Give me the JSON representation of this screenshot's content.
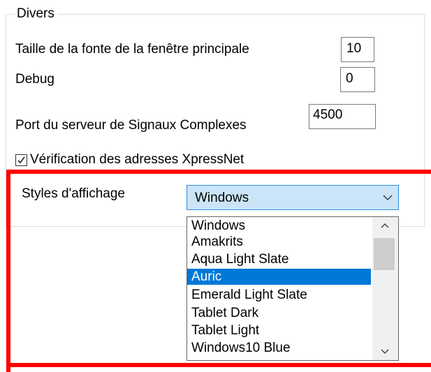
{
  "group": {
    "title": "Divers"
  },
  "fields": {
    "font_size_label": "Taille de la fonte de la fenêtre principale",
    "font_size_value": "10",
    "debug_label": "Debug",
    "debug_value": "0",
    "port_label": "Port du serveur de Signaux Complexes",
    "port_value": "4500",
    "xpressnet_check_label": "Vérification des adresses XpressNet",
    "xpressnet_checked": true
  },
  "display_style": {
    "label": "Styles d'affichage",
    "selected": "Windows",
    "options": [
      "Windows",
      "Amakrits",
      "Aqua Light Slate",
      "Auric",
      "Emerald Light Slate",
      "Tablet Dark",
      "Tablet Light",
      "Windows10 Blue"
    ],
    "highlighted_option": "Auric"
  },
  "colors": {
    "highlight_frame": "#ff0000",
    "selection": "#0078d7",
    "combo_focus": "#cce4f7"
  },
  "icons": {
    "combo_arrow": "chevron-down-icon",
    "checkbox": "checkmark-icon",
    "scroll_up": "chevron-up-icon",
    "scroll_down": "chevron-down-icon"
  }
}
